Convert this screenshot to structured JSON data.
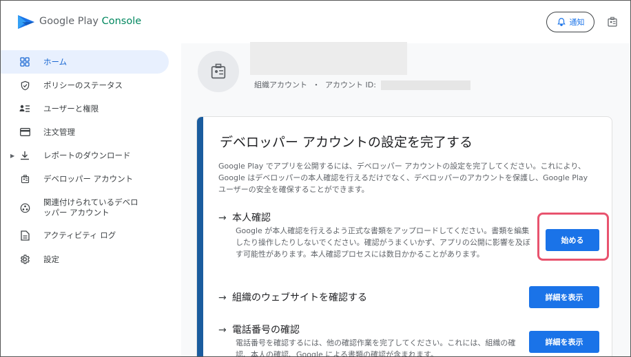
{
  "header": {
    "brand_prefix": "Google Play ",
    "brand_accent": "Console",
    "notifications_label": "通知"
  },
  "sidebar": {
    "items": [
      {
        "label": "ホーム",
        "icon": "home-grid-icon",
        "active": true
      },
      {
        "label": "ポリシーのステータス",
        "icon": "shield-icon"
      },
      {
        "label": "ユーザーと権限",
        "icon": "users-icon"
      },
      {
        "label": "注文管理",
        "icon": "credit-card-icon"
      },
      {
        "label": "レポートのダウンロード",
        "icon": "download-icon",
        "expandable": true
      },
      {
        "label": "デベロッパー アカウント",
        "icon": "account-badge-icon"
      },
      {
        "label": "関連付けられているデベロ\nッパー アカウント",
        "icon": "linked-accounts-icon"
      },
      {
        "label": "アクティビティ ログ",
        "icon": "document-icon"
      },
      {
        "label": "設定",
        "icon": "gear-icon"
      }
    ]
  },
  "account": {
    "type_label": "組織アカウント",
    "separator": "・",
    "id_label": "アカウント ID:"
  },
  "setup_card": {
    "title": "デベロッパー アカウントの設定を完了する",
    "description": "Google Play でアプリを公開するには、デベロッパー アカウントの設定を完了してください。これにより、Google はデベロッパーの本人確認を行えるだけでなく、デベロッパーのアカウントを保護し、Google Play ユーザーの安全を確保することができます。",
    "steps": [
      {
        "title": "本人確認",
        "description": "Google が本人確認を行えるよう正式な書類をアップロードしてください。書類を編集したり操作したりしないでください。確認がうまくいかず、アプリの公開に影響を及ぼす可能性があります。本人確認プロセスには数日かかることがあります。",
        "button": "始める"
      },
      {
        "title": "組織のウェブサイトを確認する",
        "button": "詳細を表示"
      },
      {
        "title": "電話番号の確認",
        "description": "電話番号を確認するには、他の確認作業を完了してください。これには、組織の確認、本人の確認、Google による書類の確認が含まれます。",
        "button": "詳細を表示"
      }
    ]
  },
  "colors": {
    "primary": "#1a73e8",
    "card_accent": "#1a5c9e",
    "highlight": "#e8536e",
    "nav_active_bg": "#e8f0fe"
  }
}
